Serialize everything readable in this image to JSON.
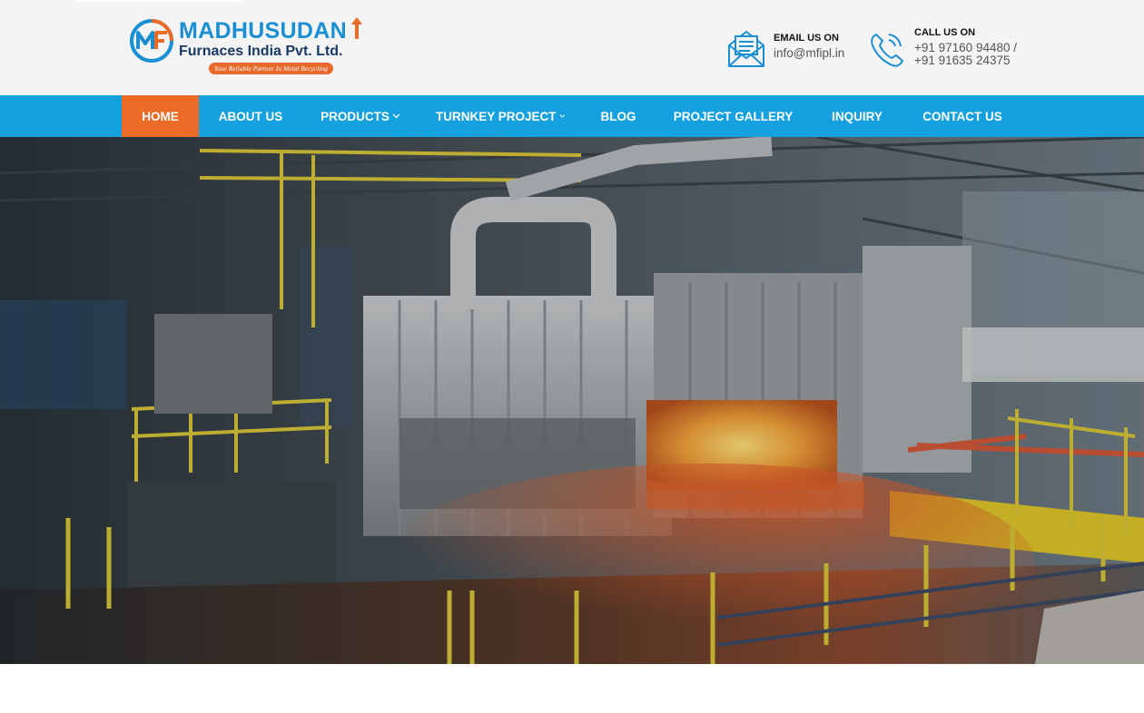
{
  "brand": {
    "name": "MADHUSUDAN",
    "subtitle": "Furnaces India Pvt. Ltd.",
    "tagline": "Your Reliable Partner In Metal Recycling",
    "primary_color": "#1b8fd3",
    "accent_color": "#ec6b27"
  },
  "contact": {
    "email_label": "EMAIL US ON",
    "email": "info@mfipl.in",
    "email_icon": "envelope-icon",
    "call_label": "CALL US ON",
    "phone_1": "+91 97160 94480 /",
    "phone_2": "+91 91635 24375",
    "phone_icon": "phone-icon"
  },
  "nav": {
    "background": "#15a0e0",
    "items": [
      {
        "label": "HOME",
        "active": true
      },
      {
        "label": "ABOUT US"
      },
      {
        "label": "PRODUCTS",
        "dropdown": true
      },
      {
        "label": "TURNKEY PROJECT",
        "dropdown": true
      },
      {
        "label": "BLOG"
      },
      {
        "label": "PROJECT GALLERY"
      },
      {
        "label": "INQUIRY"
      },
      {
        "label": "CONTACT US"
      }
    ]
  },
  "hero": {
    "image": "industrial furnace plant"
  }
}
